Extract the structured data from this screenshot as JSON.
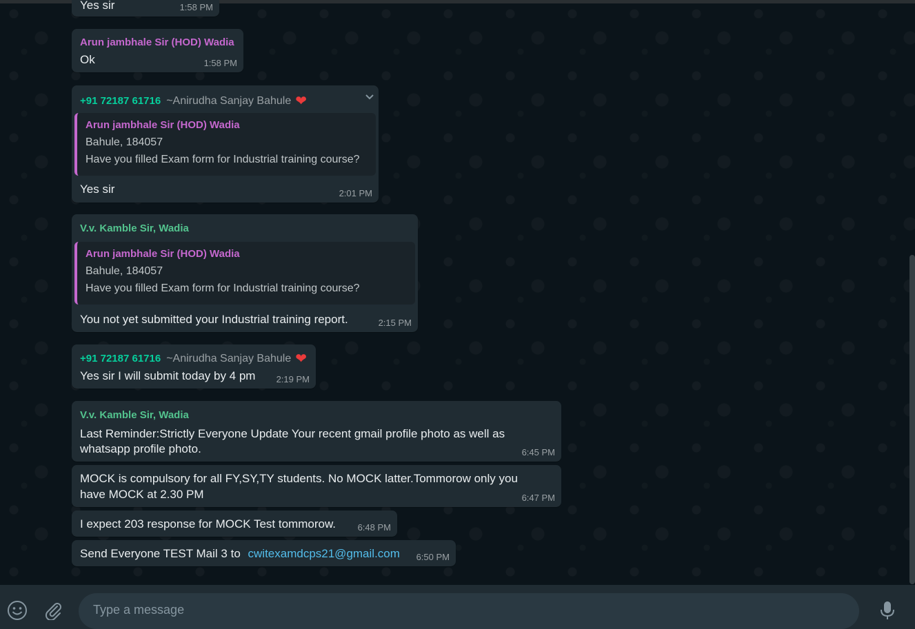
{
  "messages": [
    {
      "text": "Yes sir",
      "time": "1:58 PM"
    },
    {
      "sender": "Arun jambhale Sir (HOD) Wadia",
      "text": "Ok",
      "time": "1:58 PM"
    },
    {
      "sender_phone": "+91 72187 61716",
      "push_name": "~Anirudha Sanjay Bahule",
      "quote": {
        "sender": "Arun jambhale Sir (HOD) Wadia",
        "line1": "Bahule, 184057",
        "line2": "Have you filled Exam form for Industrial training course?"
      },
      "text": "Yes sir",
      "time": "2:01 PM"
    },
    {
      "sender": "V.v. Kamble Sir, Wadia",
      "quote": {
        "sender": "Arun jambhale Sir (HOD) Wadia",
        "line1": "Bahule, 184057",
        "line2": "Have you filled Exam form for Industrial training course?"
      },
      "text": "You not yet submitted your Industrial training report.",
      "time": "2:15 PM"
    },
    {
      "sender_phone": "+91 72187 61716",
      "push_name": "~Anirudha Sanjay Bahule",
      "text": "Yes sir I will submit today by 4 pm",
      "time": "2:19 PM"
    },
    {
      "sender": "V.v. Kamble Sir, Wadia",
      "text_line1": "Last Reminder:Strictly Everyone Update Your recent gmail profile photo as well as",
      "text_line2": "whatsapp profile photo.",
      "time": "6:45 PM"
    },
    {
      "text_line1": "MOCK is compulsory for all FY,SY,TY students. No MOCK latter.Tommorow only you",
      "text_line2": "have MOCK at 2.30 PM",
      "time": "6:47 PM"
    },
    {
      "text": "I expect 203 response for MOCK Test tommorow.",
      "time": "6:48 PM"
    },
    {
      "text": "Send Everyone TEST Mail 3 to",
      "link": "cwitexamdcps21@gmail.com",
      "time": "6:50 PM"
    }
  ],
  "composer": {
    "placeholder": "Type a message"
  },
  "icons": {
    "emoji": "emoji-icon",
    "attach": "paperclip-icon",
    "mic": "microphone-icon",
    "heart": "heart-emoji",
    "chevron": "chevron-down-icon"
  },
  "colors": {
    "bubble": "#202c33",
    "background": "#0b141a",
    "hod_name": "#c568ce",
    "kamble_name": "#53c38e",
    "phone": "#06cf9c",
    "link": "#53bdeb"
  }
}
